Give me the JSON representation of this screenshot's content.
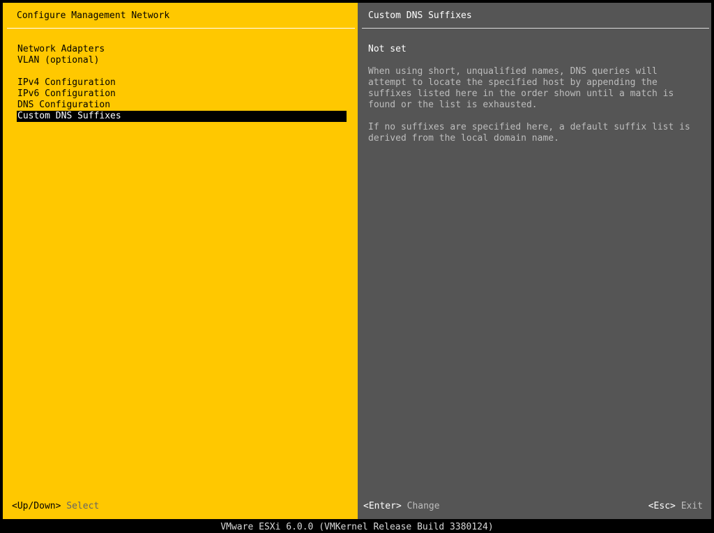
{
  "left_pane": {
    "title": "Configure Management Network",
    "menu": [
      {
        "label": "Network Adapters"
      },
      {
        "label": "VLAN (optional)"
      },
      {
        "label": "IPv4 Configuration"
      },
      {
        "label": "IPv6 Configuration"
      },
      {
        "label": "DNS Configuration"
      },
      {
        "label": "Custom DNS Suffixes"
      }
    ],
    "selected_index": 5,
    "hint_key": "<Up/Down>",
    "hint_action": "Select"
  },
  "right_pane": {
    "title": "Custom DNS Suffixes",
    "status": "Not set",
    "paragraph1": "When using short, unqualified names, DNS queries will\nattempt to locate the specified host by appending the\nsuffixes listed here in the order shown until a match is\nfound or the list is exhausted.",
    "paragraph2": "If no suffixes are specified here, a default suffix list is\nderived from the local domain name.",
    "enter_key": "<Enter>",
    "enter_action": "Change",
    "esc_key": "<Esc>",
    "esc_action": "Exit"
  },
  "status_bar": {
    "text": "VMware ESXi 6.0.0 (VMKernel Release Build 3380124)"
  },
  "colors": {
    "left_background": "#ffc800",
    "right_background": "#555555",
    "selection_background": "#000000"
  }
}
